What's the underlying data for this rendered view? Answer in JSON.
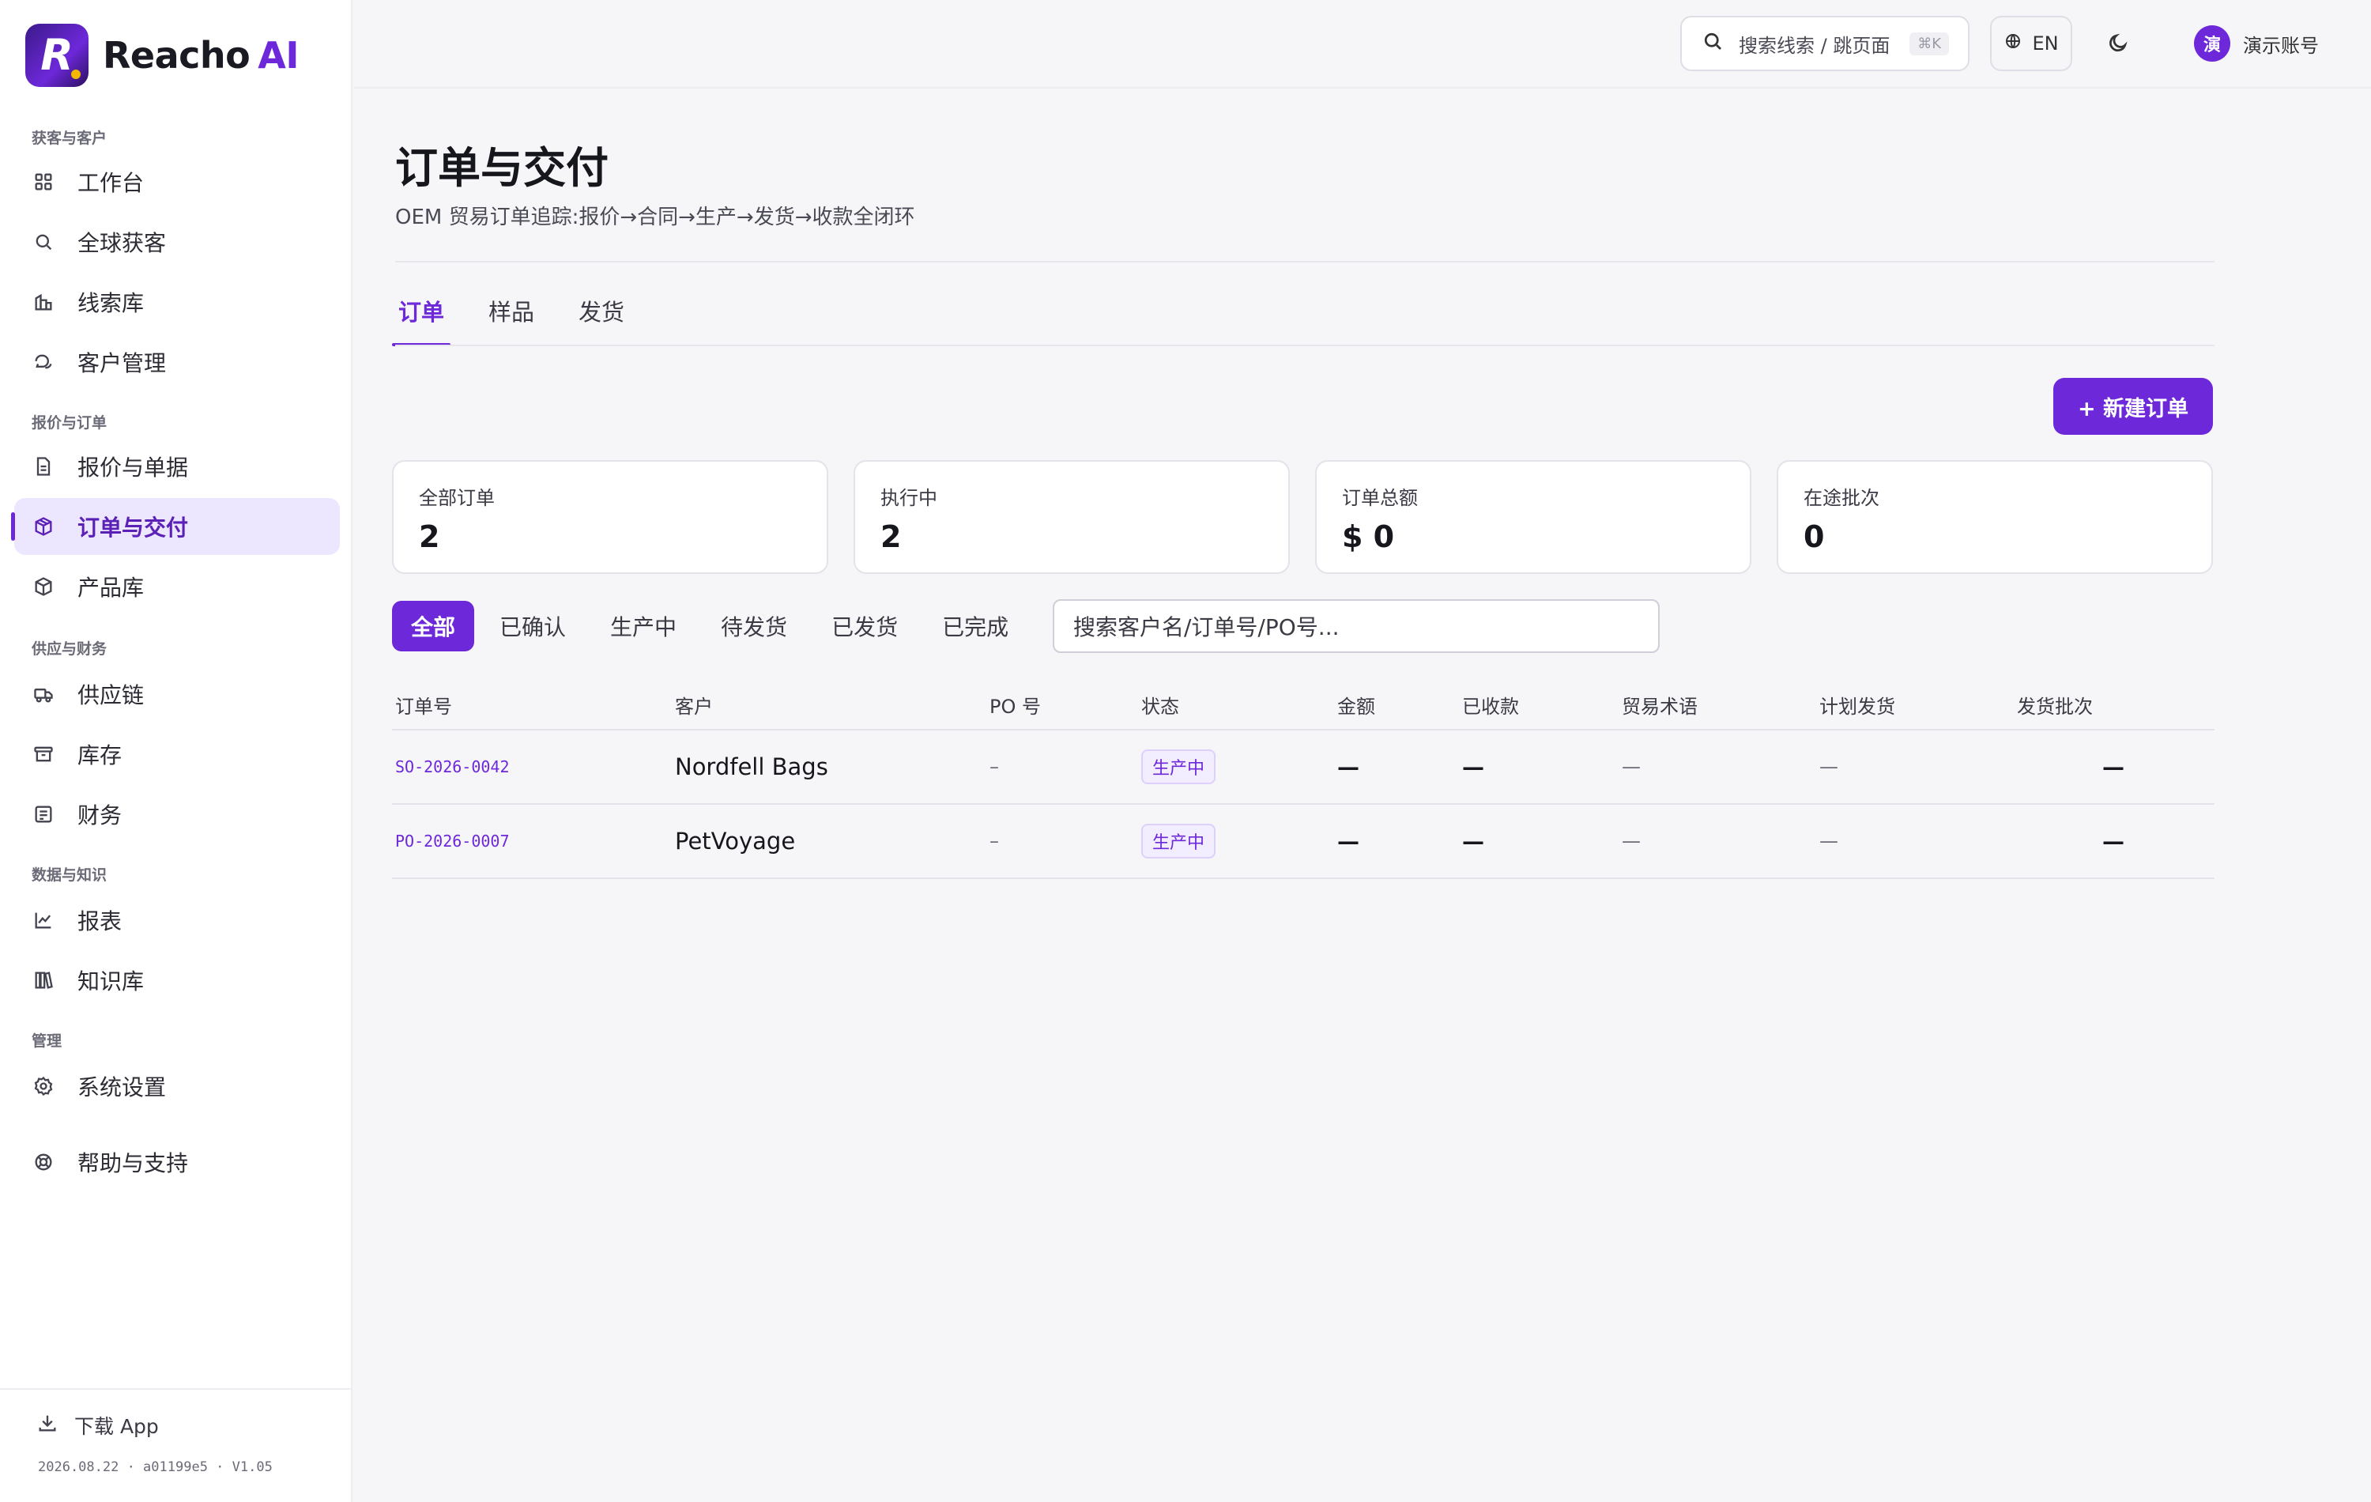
{
  "brand": {
    "name": "Reacho",
    "suffix": "AI",
    "logo_letter": "R"
  },
  "sidebar": {
    "sections": [
      {
        "label": "获客与客户"
      },
      {
        "label": "报价与订单"
      },
      {
        "label": "供应与财务"
      },
      {
        "label": "数据与知识"
      },
      {
        "label": "管理"
      }
    ],
    "items": [
      {
        "label": "工作台",
        "icon": "grid-icon"
      },
      {
        "label": "全球获客",
        "icon": "search-icon"
      },
      {
        "label": "线索库",
        "icon": "building-icon"
      },
      {
        "label": "客户管理",
        "icon": "chat-icon"
      },
      {
        "label": "报价与单据",
        "icon": "document-icon"
      },
      {
        "label": "订单与交付",
        "icon": "package-icon",
        "active": true
      },
      {
        "label": "产品库",
        "icon": "cube-icon"
      },
      {
        "label": "供应链",
        "icon": "truck-icon"
      },
      {
        "label": "库存",
        "icon": "archive-icon"
      },
      {
        "label": "财务",
        "icon": "receipt-icon"
      },
      {
        "label": "报表",
        "icon": "chart-icon"
      },
      {
        "label": "知识库",
        "icon": "books-icon"
      },
      {
        "label": "系统设置",
        "icon": "gear-icon"
      },
      {
        "label": "帮助与支持",
        "icon": "lifebuoy-icon"
      }
    ],
    "download_label": "下载 App",
    "version": "2026.08.22 · a01199e5 · V1.05"
  },
  "topbar": {
    "search_placeholder": "搜索线索 / 跳页面",
    "shortcut": "⌘K",
    "lang": "EN",
    "account_initial": "演",
    "account_name": "演示账号"
  },
  "page": {
    "title": "订单与交付",
    "subtitle": "OEM 贸易订单追踪:报价→合同→生产→发货→收款全闭环"
  },
  "tabs": [
    {
      "label": "订单",
      "active": true
    },
    {
      "label": "样品"
    },
    {
      "label": "发货"
    }
  ],
  "new_order_label": "+ 新建订单",
  "stats": [
    {
      "label": "全部订单",
      "value": "2"
    },
    {
      "label": "执行中",
      "value": "2"
    },
    {
      "label": "订单总额",
      "value": "$ 0"
    },
    {
      "label": "在途批次",
      "value": "0"
    }
  ],
  "filters": [
    "全部",
    "已确认",
    "生产中",
    "待发货",
    "已发货",
    "已完成"
  ],
  "filter_search_placeholder": "搜索客户名/订单号/PO号...",
  "table": {
    "columns": [
      "订单号",
      "客户",
      "PO 号",
      "状态",
      "金额",
      "已收款",
      "贸易术语",
      "计划发货",
      "发货批次"
    ],
    "rows": [
      {
        "order_no": "SO-2026-0042",
        "customer": "Nordfell Bags",
        "po": "–",
        "status": "生产中",
        "amount": "—",
        "received": "—",
        "incoterm": "—",
        "planned_ship": "—",
        "batches": "—"
      },
      {
        "order_no": "PO-2026-0007",
        "customer": "PetVoyage",
        "po": "–",
        "status": "生产中",
        "amount": "—",
        "received": "—",
        "incoterm": "—",
        "planned_ship": "—",
        "batches": "—"
      }
    ]
  },
  "colors": {
    "accent": "#6d28d9",
    "accent_soft": "#ede6ff",
    "background": "#f6f6f9"
  }
}
